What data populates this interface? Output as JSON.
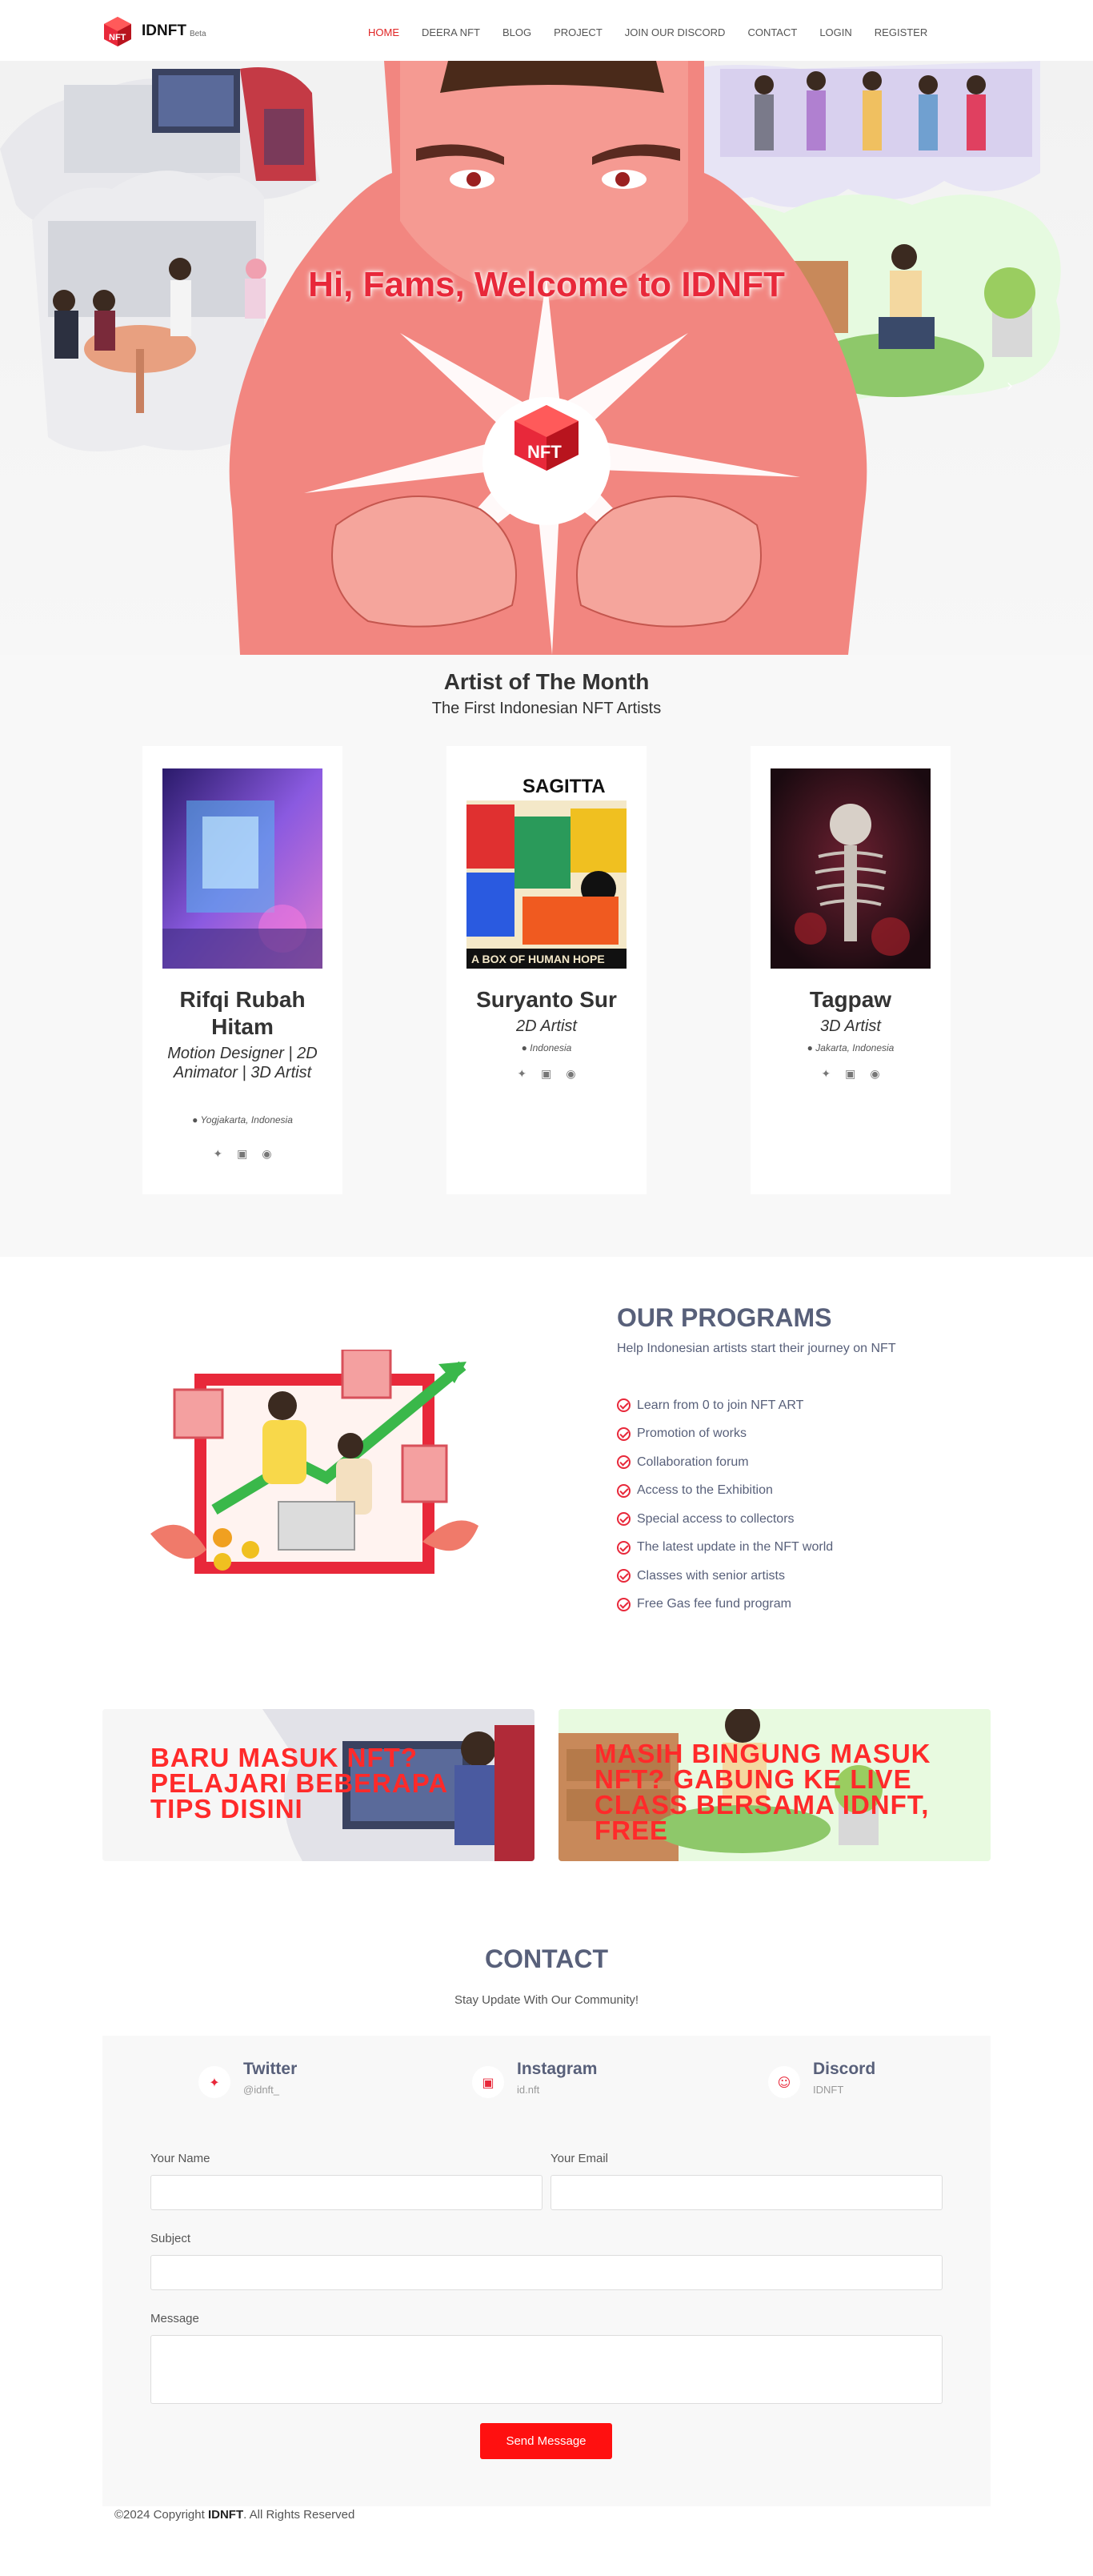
{
  "header": {
    "brand": "IDNFT",
    "beta": "Beta",
    "nav": [
      "HOME",
      "DEERA NFT",
      "BLOG",
      "PROJECT",
      "JOIN OUR DISCORD",
      "CONTACT",
      "LOGIN",
      "REGISTER"
    ]
  },
  "hero": {
    "title": "Hi, Fams, Welcome to IDNFT",
    "logo_text": "NFT"
  },
  "artists": {
    "title": "Artist of The Month",
    "subtitle": "The First Indonesian NFT Artists",
    "cards": [
      {
        "name": "Rifqi Rubah Hitam",
        "role": "Motion Designer | 2D Animator | 3D Artist",
        "location": "Yogjakarta, Indonesia"
      },
      {
        "name": "Suryanto Sur",
        "role": "2D Artist",
        "location": "Indonesia",
        "art_text_1": "SAGITTA",
        "art_text_2": "A BOX OF HUMAN HOPE"
      },
      {
        "name": "Tagpaw",
        "role": "3D Artist",
        "location": "Jakarta, Indonesia"
      }
    ]
  },
  "programs": {
    "title": "OUR PROGRAMS",
    "subtitle": "Help Indonesian artists start their journey on NFT",
    "items": [
      "Learn from 0 to join NFT ART",
      "Promotion of works",
      "Collaboration forum",
      "Access to the Exhibition",
      "Special access to collectors",
      "The latest update in the NFT world",
      "Classes with senior artists",
      "Free Gas fee fund program"
    ]
  },
  "banners": [
    {
      "text": "BARU MASUK NFT? PELAJARI BEBERAPA TIPS DISINI"
    },
    {
      "text": "MASIH BINGUNG MASUK NFT? GABUNG KE LIVE CLASS BERSAMA IDNFT, FREE"
    }
  ],
  "contact": {
    "title": "CONTACT",
    "subtitle": "Stay Update With Our Community!",
    "channels": [
      {
        "name": "Twitter",
        "handle": "@idnft_"
      },
      {
        "name": "Instagram",
        "handle": "id.nft"
      },
      {
        "name": "Discord",
        "handle": "IDNFT"
      }
    ],
    "labels": {
      "name": "Your Name",
      "email": "Your Email",
      "subject": "Subject",
      "message": "Message"
    },
    "send": "Send Message"
  },
  "footer": {
    "prefix": "©2024 Copyright ",
    "brand": "IDNFT",
    "suffix": ". All Rights Reserved"
  },
  "colors": {
    "accent": "#e8283a",
    "heading": "#58607a",
    "button": "#ff1010"
  }
}
